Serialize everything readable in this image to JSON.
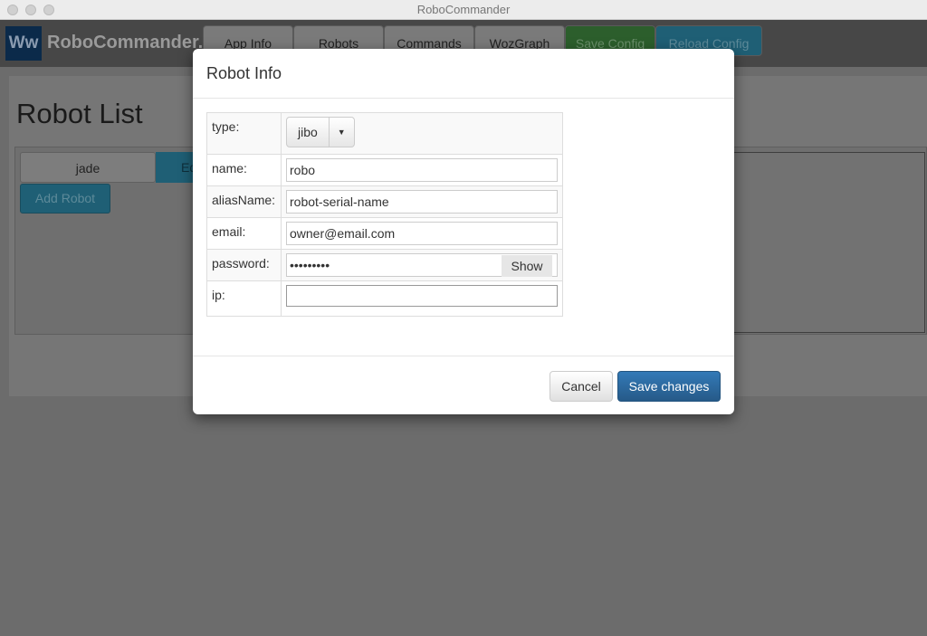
{
  "window": {
    "title": "RoboCommander"
  },
  "nav": {
    "logo": "Ww",
    "brand": "RoboCommander.io",
    "tabs": [
      "App Info",
      "Robots",
      "Commands",
      "WozGraph"
    ],
    "save_config": "Save Config",
    "reload_config": "Reload Config"
  },
  "page": {
    "title": "Robot List",
    "robots": [
      "jade"
    ],
    "edit_label": "Ed",
    "add_robot": "Add Robot"
  },
  "modal": {
    "title": "Robot Info",
    "fields": {
      "type": {
        "label": "type:",
        "value": "jibo"
      },
      "name": {
        "label": "name:",
        "value": "robo"
      },
      "alias": {
        "label": "aliasName:",
        "value": "robot-serial-name"
      },
      "email": {
        "label": "email:",
        "value": "owner@email.com"
      },
      "password": {
        "label": "password:",
        "value": "•••••••••",
        "show": "Show"
      },
      "ip": {
        "label": "ip:",
        "value": ""
      }
    },
    "cancel": "Cancel",
    "save": "Save changes"
  },
  "colors": {
    "primary": "#337ab7",
    "success": "#2e7d32",
    "info": "#1f5f75"
  }
}
